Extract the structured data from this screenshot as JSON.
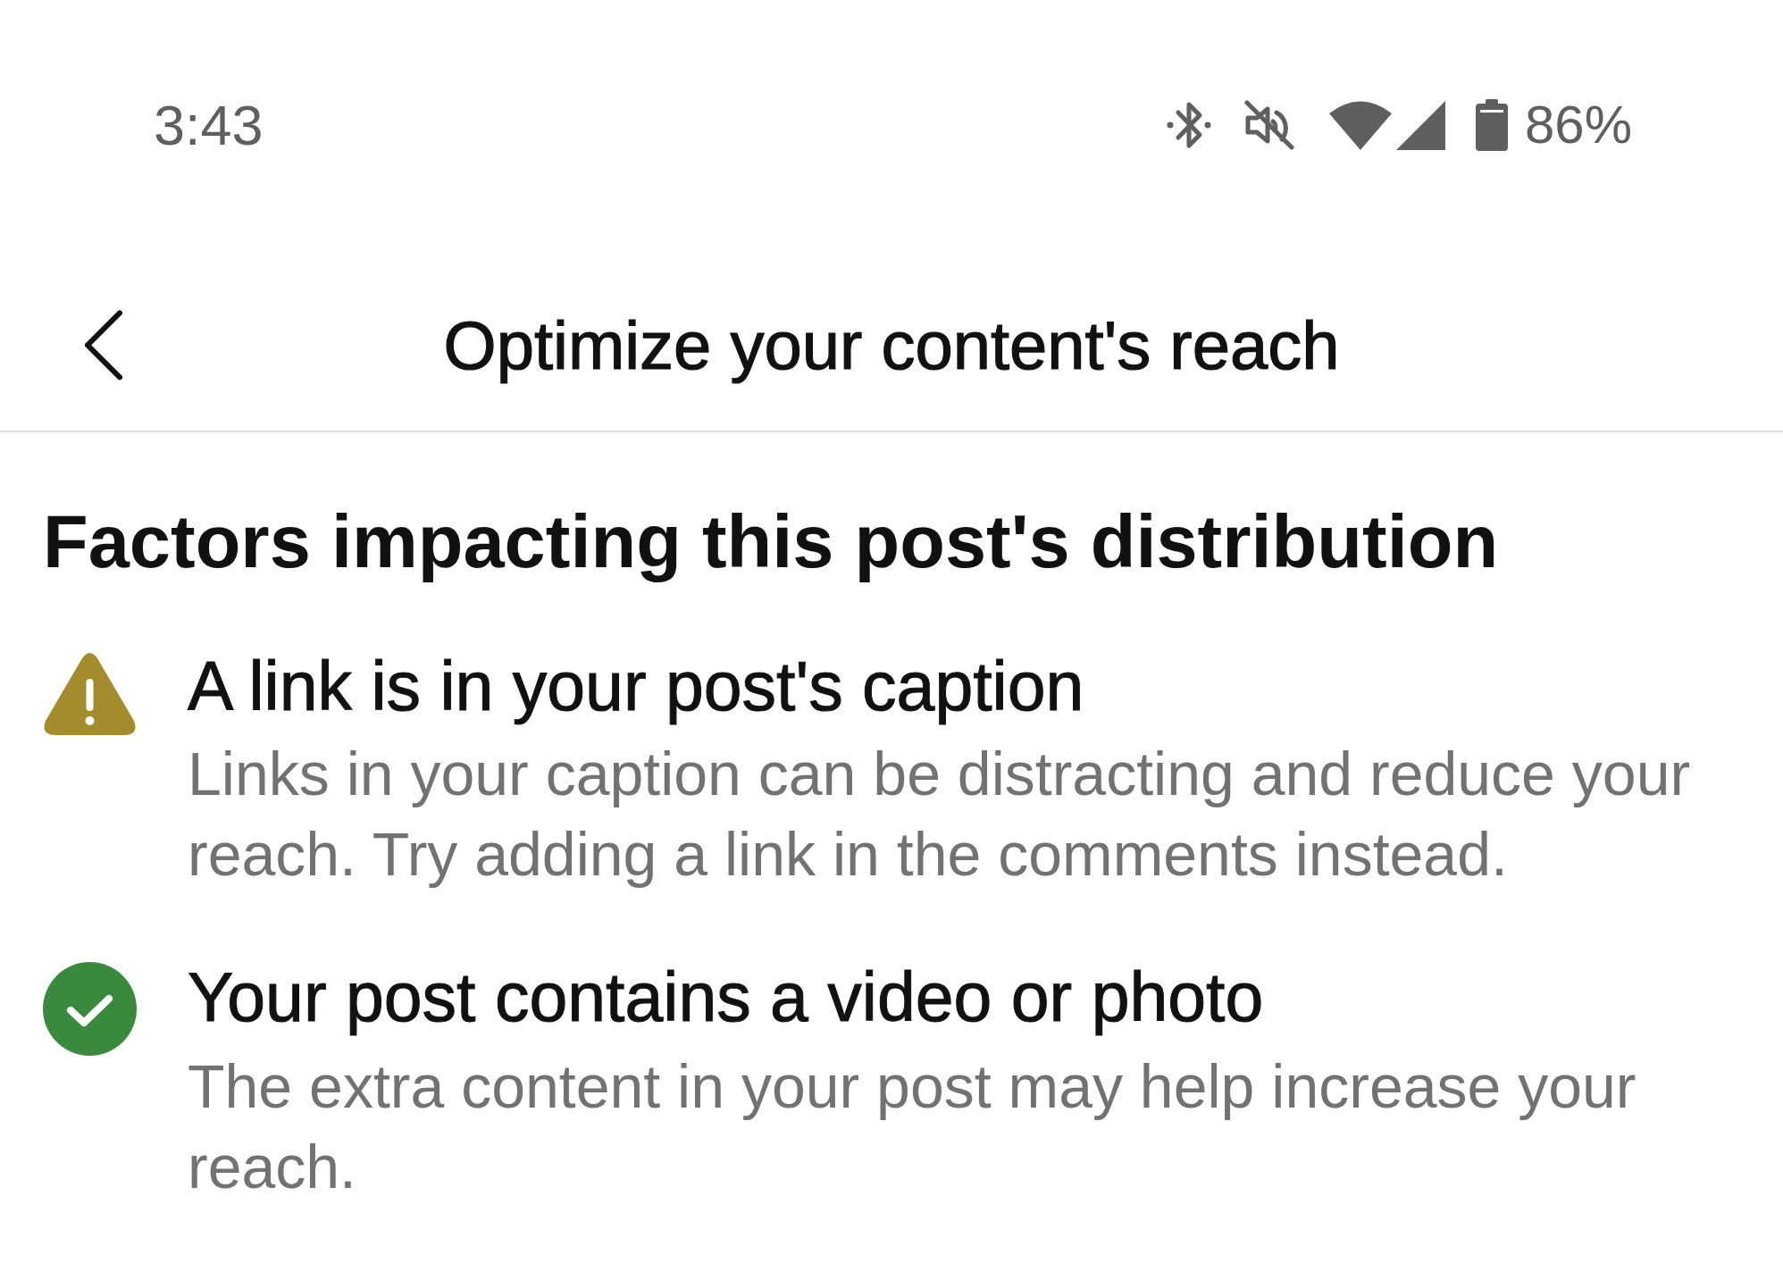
{
  "status_bar": {
    "time": "3:43",
    "battery": "86%"
  },
  "header": {
    "title": "Optimize your content's reach"
  },
  "section": {
    "title": "Factors impacting this post's distribution",
    "factors": [
      {
        "kind": "warning",
        "title": "A link is in your post's caption",
        "description": "Links in your caption can be distracting and reduce your reach. Try adding a link in the comments instead."
      },
      {
        "kind": "positive",
        "title": "Your post contains a video or photo",
        "description": "The extra content in your post may help increase your reach."
      }
    ]
  }
}
